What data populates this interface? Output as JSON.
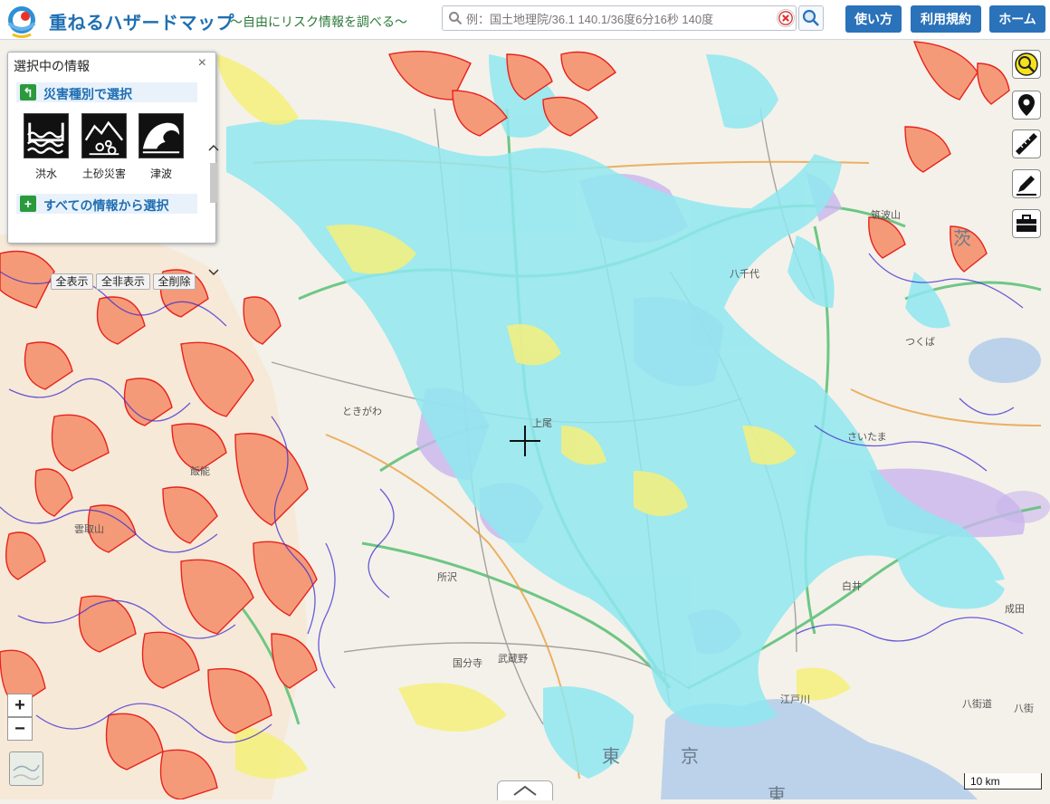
{
  "header": {
    "title": "重ねるハザードマップ",
    "subtitle": "～自由にリスク情報を調べる～",
    "search_placeholder": "例：国土地理院/36.1 140.1/36度6分16秒 140度",
    "buttons": {
      "howto": "使い方",
      "terms": "利用規約",
      "home": "ホーム"
    }
  },
  "panel": {
    "title": "選択中の情報",
    "close": "×",
    "section_by_type": "災害種別で選択",
    "section_all": "すべての情報から選択",
    "hazards": [
      {
        "label": "洪水",
        "icon": "flood-icon"
      },
      {
        "label": "土砂災害",
        "icon": "landslide-icon"
      },
      {
        "label": "津波",
        "icon": "tsunami-icon"
      }
    ],
    "actions": {
      "show_all": "全表示",
      "hide_all": "全非表示",
      "delete_all": "全削除"
    }
  },
  "map": {
    "labels": {
      "tokyo": "東",
      "kyo": "京",
      "ibaraki": "茨",
      "higashi": "東",
      "mitsukaidou": "八千代",
      "kurihashi": "さいたま",
      "tokigawa": "ときがわ",
      "tokorozawa": "所沢",
      "musashino": "武蔵野",
      "kokubunji": "国分寺",
      "edogawa": "江戸川",
      "shirai": "白井",
      "narita": "成田",
      "tsukubamirai": "つくば",
      "mt_tsukuba": "筑波山",
      "ageo": "上尾",
      "hanno": "飯能",
      "kumogatori": "雲取山",
      "yokota": "八街道",
      "kasai": "八街"
    },
    "scale": "10 km",
    "colors": {
      "flood_cyan": "#8fe8f0",
      "flood_yellow": "#f5f07a",
      "flood_purple": "#c9b5ec",
      "landslide_orange": "#f59a78",
      "landslide_red": "#e8221d",
      "contour_blue": "#3a2bd1",
      "road_green": "#5fc27a",
      "bay": "#bcd2ea"
    }
  },
  "tools": [
    "hazard-icon",
    "pin-icon",
    "ruler-icon",
    "pencil-icon",
    "toolbox-icon"
  ],
  "zoom": {
    "in": "+",
    "out": "−"
  }
}
